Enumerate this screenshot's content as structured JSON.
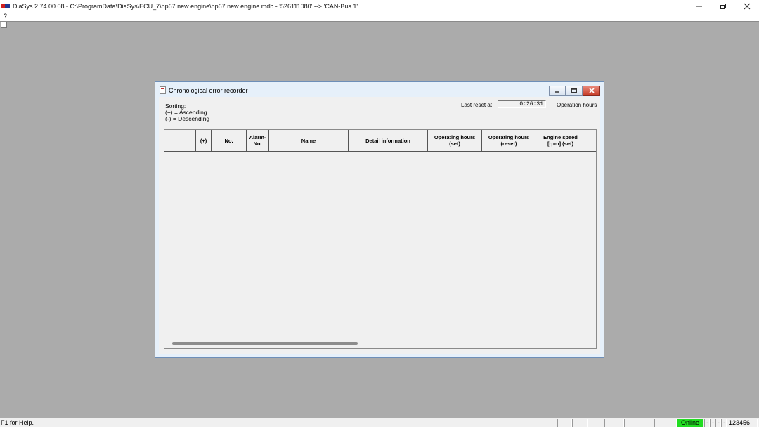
{
  "app": {
    "title": "DiaSys 2.74.00.08 - C:\\ProgramData\\DiaSys\\ECU_7\\hp67 new engine\\hp67 new engine.mdb - '526111080' --> 'CAN-Bus 1'"
  },
  "menu": {
    "help": "?"
  },
  "window": {
    "title": "Chronological error recorder",
    "sorting": {
      "label": "Sorting:",
      "ascending": "(+) = Ascending",
      "descending": "(-) = Descending"
    },
    "last_reset_label": "Last reset at",
    "last_reset_value": "0:26:31",
    "unit_label": "Operation hours"
  },
  "table": {
    "columns": [
      {
        "line1": "",
        "line2": ""
      },
      {
        "line1": "(+)",
        "line2": ""
      },
      {
        "line1": "No.",
        "line2": ""
      },
      {
        "line1": "Alarm-",
        "line2": "No."
      },
      {
        "line1": "Name",
        "line2": ""
      },
      {
        "line1": "Detail information",
        "line2": ""
      },
      {
        "line1": "Operating hours",
        "line2": "(set)"
      },
      {
        "line1": "Operating hours",
        "line2": "(reset)"
      },
      {
        "line1": "Engine speed",
        "line2": "[rpm] (set)"
      }
    ],
    "rows": []
  },
  "statusbar": {
    "help_text": "F1 for Help.",
    "online": "Online",
    "flags": [
      "-",
      "-",
      "-",
      "-"
    ],
    "id": "123456"
  }
}
